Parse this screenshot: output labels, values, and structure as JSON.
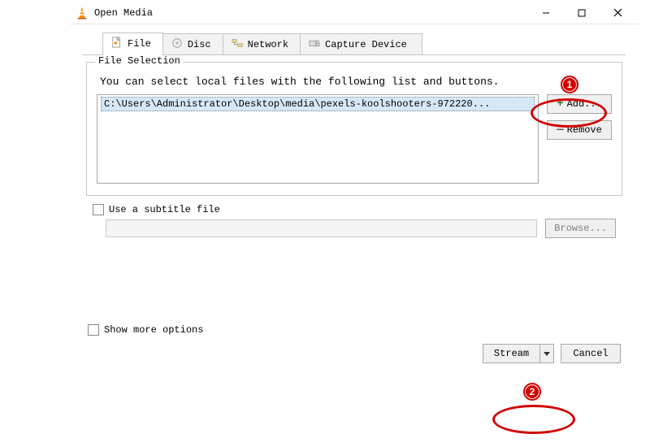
{
  "window": {
    "title": "Open Media"
  },
  "tabs": {
    "file": "File",
    "disc": "Disc",
    "network": "Network",
    "capture": "Capture Device"
  },
  "file_selection": {
    "legend": "File Selection",
    "hint": "You can select local files with the following list and buttons.",
    "selected_item": "C:\\Users\\Administrator\\Desktop\\media\\pexels-koolshooters-972220...",
    "add_label": "Add...",
    "remove_label": "Remove"
  },
  "subtitle": {
    "checkbox_label": "Use a subtitle file",
    "browse_label": "Browse..."
  },
  "more_options_label": "Show more options",
  "footer": {
    "stream_label": "Stream",
    "cancel_label": "Cancel"
  },
  "annotations": {
    "badge1": "1",
    "badge2": "2"
  }
}
